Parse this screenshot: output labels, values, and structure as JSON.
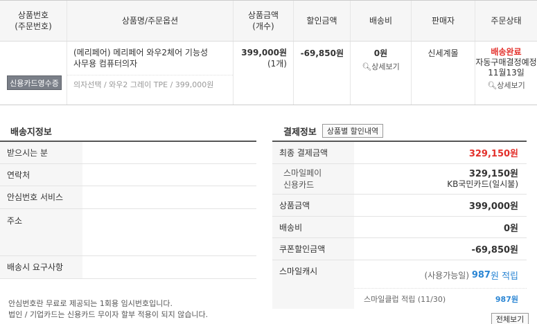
{
  "order_table": {
    "headers": [
      "상품번호\n(주문번호)",
      "상품명/주문옵션",
      "상품금액\n(개수)",
      "할인금액",
      "배송비",
      "판매자",
      "주문상태"
    ],
    "receipt_button": "신용카드영수증",
    "product_name": "(메리페어) 메리페어 와우2체어 기능성 사무용 컴퓨터의자",
    "product_option": "의자선택 / 와우2 그레이 TPE / 399,000원",
    "price": "399,000원",
    "quantity": "(1개)",
    "discount": "-69,850원",
    "shipping_fee": "0원",
    "detail_link": "상세보기",
    "seller": "신세계몰",
    "status_main": "배송완료",
    "status_sub": "자동구매결정예정 11월13일",
    "status_detail_link": "상세보기"
  },
  "shipping_info": {
    "title": "배송지정보",
    "rows": [
      {
        "label": "받으시는 분",
        "value": ""
      },
      {
        "label": "연락처",
        "value": ""
      },
      {
        "label": "안심번호 서비스",
        "value": ""
      },
      {
        "label": "주소",
        "value": ""
      },
      {
        "label": "배송시 요구사항",
        "value": ""
      }
    ],
    "notes": "안심번호란 무료로 제공되는 1회용 임시번호입니다.\n법인 / 기업카드는 신용카드 무이자 할부 적용이 되지 않습니다."
  },
  "payment_info": {
    "title": "결제정보",
    "discount_button": "상품별 할인내역",
    "final_label": "최종 결제금액",
    "final_value": "329,150원",
    "method_label_1": "스마일페이",
    "method_label_2": "신용카드",
    "method_amount": "329,150원",
    "method_card": "KB국민카드(일시불)",
    "product_amount_label": "상품금액",
    "product_amount": "399,000원",
    "shipping_label": "배송비",
    "shipping_value": "0원",
    "coupon_label": "쿠폰할인금액",
    "coupon_value": "-69,850원",
    "cash_label": "스마일캐시",
    "cash_available_prefix": "(사용가능일)",
    "cash_amount": "987",
    "cash_suffix": "원 적립",
    "club_label": "스마일클럽 적립 (11/30)",
    "club_value": "987원"
  },
  "footer": {
    "more_button": "전체보기"
  }
}
